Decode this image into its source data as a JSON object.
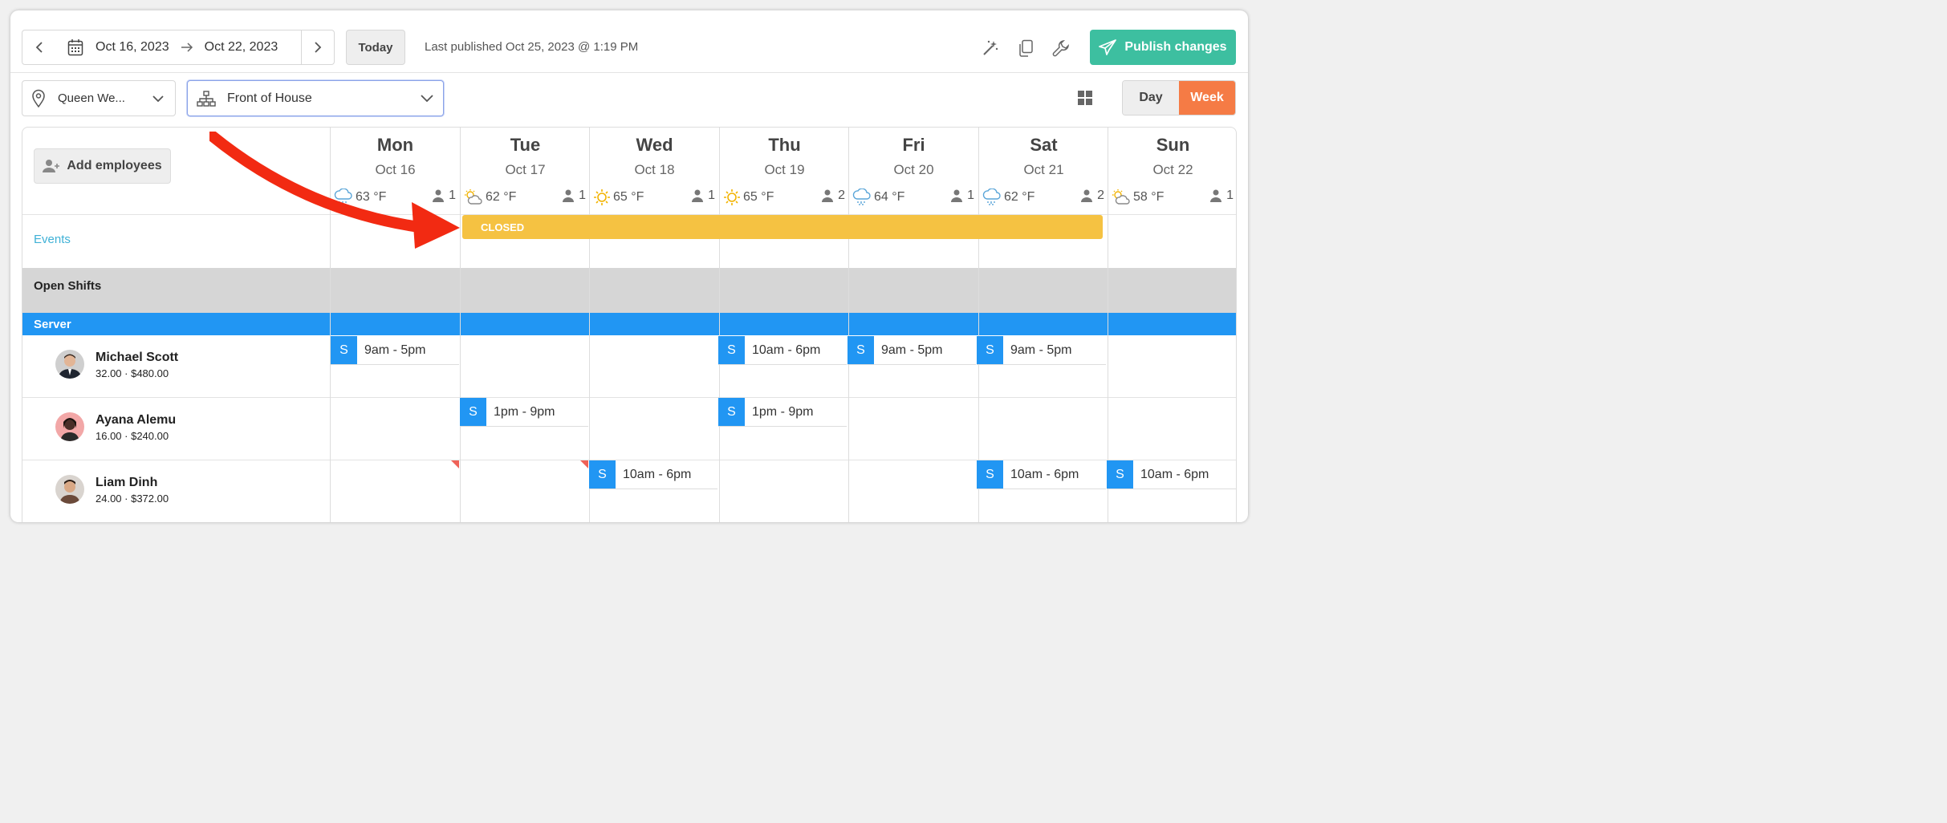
{
  "toolbar": {
    "start_date": "Oct 16, 2023",
    "end_date": "Oct 22, 2023",
    "today_label": "Today",
    "last_published": "Last published Oct 25, 2023 @ 1:19 PM",
    "publish_label": "Publish changes"
  },
  "filters": {
    "location": "Queen We...",
    "department": "Front of House",
    "day_label": "Day",
    "week_label": "Week"
  },
  "schedule": {
    "add_employees_label": "Add employees",
    "events_label": "Events",
    "closed_label": "CLOSED",
    "open_shifts_label": "Open Shifts",
    "role_label": "Server",
    "days": [
      {
        "name": "Mon",
        "date": "Oct 16",
        "weather": "rain-cloud-icon",
        "temp": "63 °F",
        "count": "1"
      },
      {
        "name": "Tue",
        "date": "Oct 17",
        "weather": "partly-sunny-icon",
        "temp": "62 °F",
        "count": "1"
      },
      {
        "name": "Wed",
        "date": "Oct 18",
        "weather": "sun-icon",
        "temp": "65 °F",
        "count": "1"
      },
      {
        "name": "Thu",
        "date": "Oct 19",
        "weather": "sun-icon",
        "temp": "65 °F",
        "count": "2"
      },
      {
        "name": "Fri",
        "date": "Oct 20",
        "weather": "rain-cloud-icon",
        "temp": "64 °F",
        "count": "1"
      },
      {
        "name": "Sat",
        "date": "Oct 21",
        "weather": "rain-cloud-icon",
        "temp": "62 °F",
        "count": "2"
      },
      {
        "name": "Sun",
        "date": "Oct 22",
        "weather": "partly-sunny-icon",
        "temp": "58 °F",
        "count": "1"
      }
    ],
    "employees": [
      {
        "name": "Michael Scott",
        "rate": "32.00 · $480.00"
      },
      {
        "name": "Ayana Alemu",
        "rate": "16.00 · $240.00"
      },
      {
        "name": "Liam Dinh",
        "rate": "24.00 · $372.00"
      }
    ],
    "shift_badge": "S",
    "shifts": {
      "ms_mon": "9am - 5pm",
      "ms_thu": "10am - 6pm",
      "ms_fri": "9am - 5pm",
      "ms_sat": "9am - 5pm",
      "aa_tue": "1pm - 9pm",
      "aa_thu": "1pm - 9pm",
      "ld_wed": "10am - 6pm",
      "ld_sat": "10am - 6pm",
      "ld_sun": "10am - 6pm"
    }
  },
  "colors": {
    "accent": "#3dbfa0",
    "week": "#f57b45",
    "role": "#2196f3",
    "closed": "#f5c242",
    "events": "#3fb1d6"
  }
}
